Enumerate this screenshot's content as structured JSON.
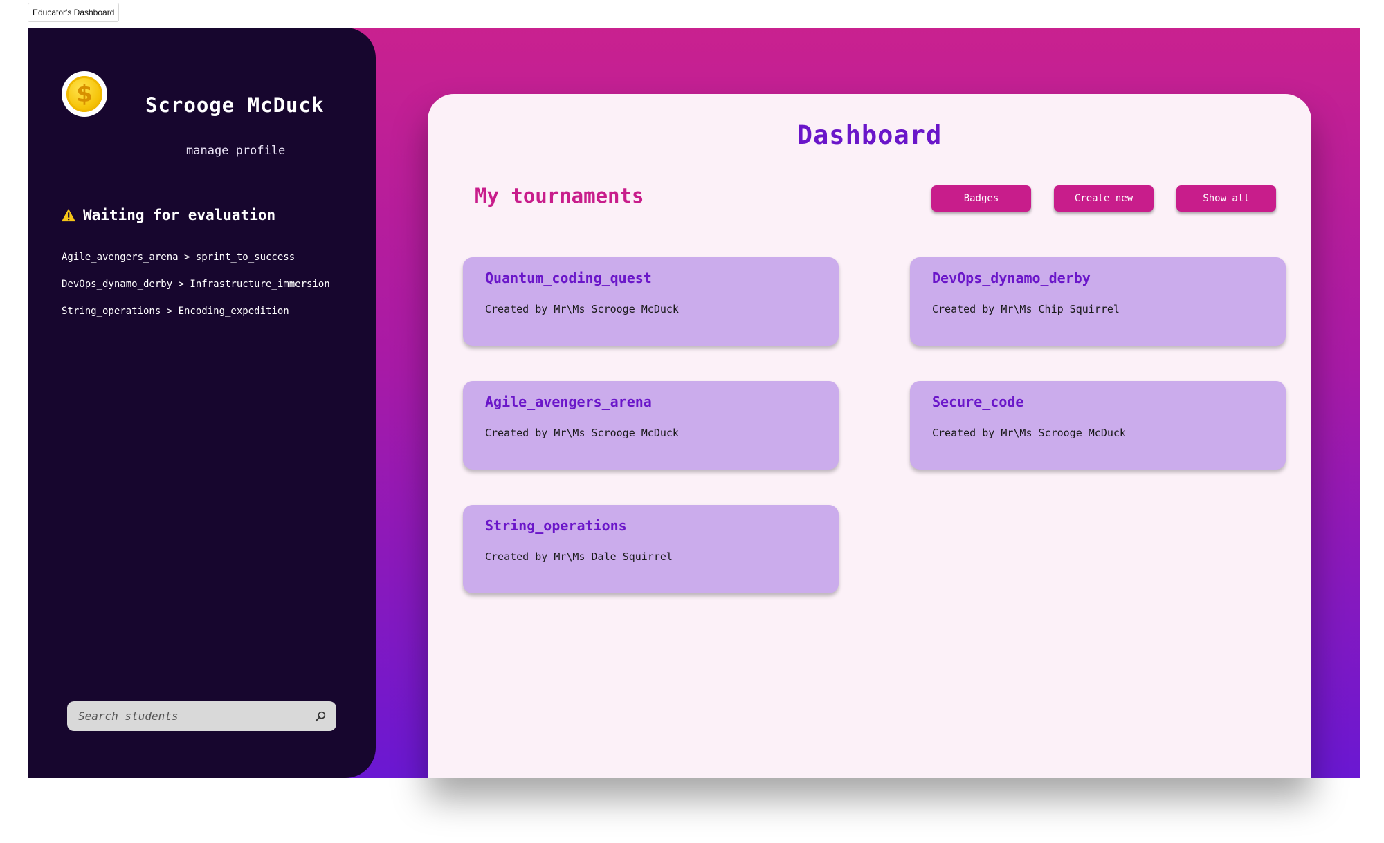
{
  "window": {
    "tab_label": "Educator's Dashboard"
  },
  "colors": {
    "sidebar_bg": "#17062e",
    "accent_pink": "#c81d8b",
    "accent_purple": "#6a16c9",
    "card_bg": "#cbacec",
    "panel_bg": "#fcf1f8"
  },
  "sidebar": {
    "avatar_icon": "dollar-coin-icon",
    "username": "Scrooge McDuck",
    "manage_profile": "manage profile",
    "waiting_icon": "warning-icon",
    "waiting_title": "Waiting for evaluation",
    "evaluations": [
      "Agile_avengers_arena > sprint_to_success",
      "DevOps_dynamo_derby > Infrastructure_immersion",
      "String_operations > Encoding_expedition"
    ],
    "search": {
      "placeholder": "Search students",
      "value": "",
      "icon": "magnifier-icon"
    }
  },
  "main": {
    "title": "Dashboard",
    "section_title": "My tournaments",
    "buttons": {
      "badges": "Badges",
      "create_new": "Create new",
      "show_all": "Show all"
    },
    "tournaments": [
      {
        "name": "Quantum_coding_quest",
        "creator": "Created by Mr\\Ms Scrooge McDuck"
      },
      {
        "name": "DevOps_dynamo_derby",
        "creator": "Created by Mr\\Ms Chip Squirrel"
      },
      {
        "name": "Agile_avengers_arena",
        "creator": "Created by Mr\\Ms Scrooge McDuck"
      },
      {
        "name": "Secure_code",
        "creator": "Created by Mr\\Ms Scrooge McDuck"
      },
      {
        "name": "String_operations",
        "creator": "Created by Mr\\Ms Dale Squirrel"
      }
    ]
  }
}
